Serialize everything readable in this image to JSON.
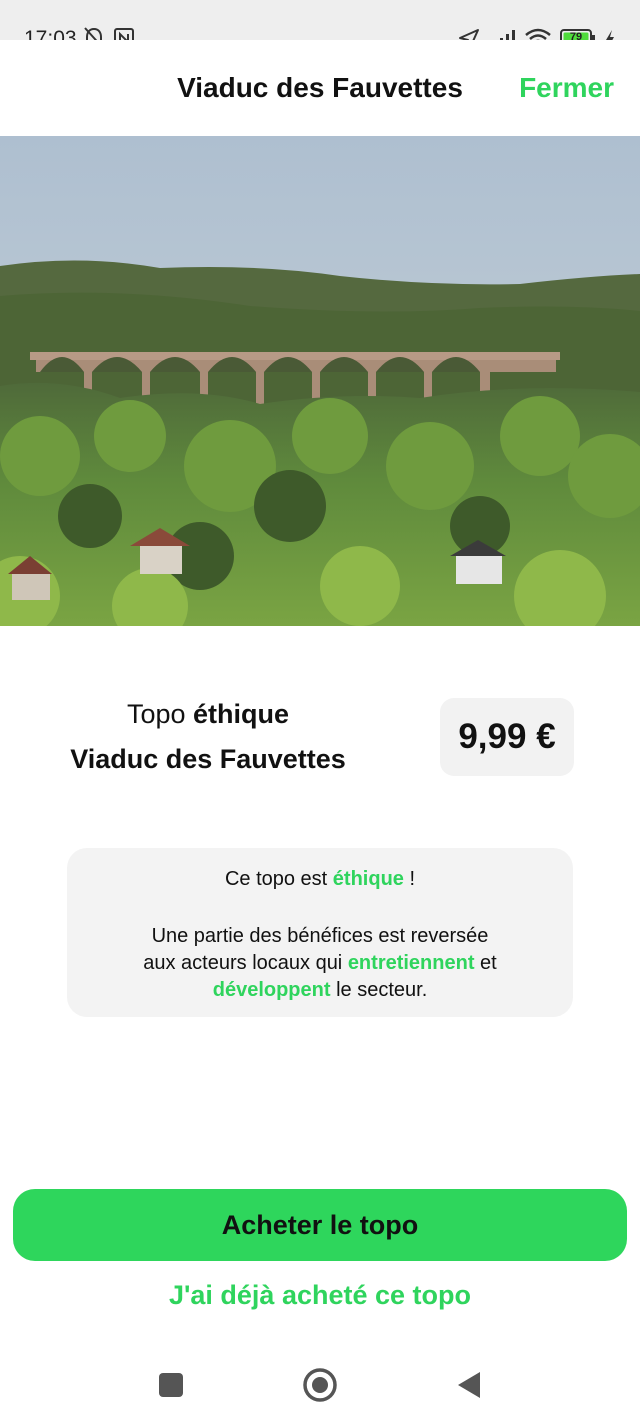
{
  "status_bar": {
    "time": "17:03",
    "battery_level": "79",
    "icons": [
      "bell-off-icon",
      "nfc-icon",
      "location-arrow-icon",
      "signal-icon",
      "wifi-icon",
      "battery-icon",
      "charging-bolt-icon"
    ]
  },
  "header": {
    "title": "Viaduc des Fauvettes",
    "close_label": "Fermer"
  },
  "topo": {
    "prefix": "Topo ",
    "kind": "éthique",
    "name": "Viaduc des Fauvettes",
    "price": "9,99 €"
  },
  "ethics_card": {
    "line1_a": "Ce topo est ",
    "line1_b": "éthique",
    "line1_c": " !",
    "line2": "Une partie des bénéfices est reversée",
    "line3_a": "aux acteurs locaux qui ",
    "line3_b": "entretiennent",
    "line3_c": " et",
    "line4_a": "développent",
    "line4_b": " le secteur."
  },
  "actions": {
    "buy_label": "Acheter le topo",
    "already_label": "J'ai déjà acheté ce topo"
  },
  "nav": {
    "icons": [
      "recents-square-icon",
      "home-circle-icon",
      "back-triangle-icon"
    ]
  },
  "colors": {
    "accent": "#2fd45d",
    "button": "#2ed65c",
    "card": "#f3f3f3"
  }
}
